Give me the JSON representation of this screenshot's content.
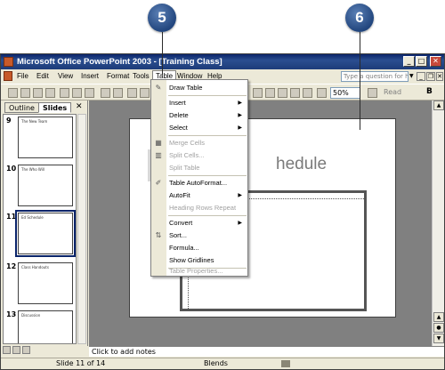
{
  "callouts": [
    "5",
    "6"
  ],
  "window": {
    "title": "Microsoft Office PowerPoint 2003 - [Training Class]",
    "buttons": {
      "minimize": "_",
      "maximize": "□",
      "close": "✕"
    }
  },
  "menubar": {
    "items": [
      "File",
      "Edit",
      "View",
      "Insert",
      "Format",
      "Tools",
      "Table",
      "Window",
      "Help"
    ],
    "help_placeholder": "Type a question for help",
    "mdi": {
      "minimize": "_",
      "restore": "❐",
      "close": "✕"
    }
  },
  "toolbar": {
    "zoom": "50%",
    "read": "Read",
    "bold": "B"
  },
  "leftpane": {
    "tabs": [
      "Outline",
      "Slides"
    ],
    "close": "✕",
    "slides": [
      {
        "num": "9",
        "title": "The New Team"
      },
      {
        "num": "10",
        "title": "The Who Will"
      },
      {
        "num": "11",
        "title": "Ed Schedule"
      },
      {
        "num": "12",
        "title": "Class Handouts"
      },
      {
        "num": "13",
        "title": "Discussion"
      }
    ]
  },
  "slide": {
    "heading": "hedule"
  },
  "table_menu": {
    "items": [
      {
        "label": "Draw Table",
        "icon": "pencil-icon",
        "disabled": false,
        "submenu": false
      },
      {
        "label": "Insert",
        "disabled": false,
        "submenu": true
      },
      {
        "label": "Delete",
        "disabled": false,
        "submenu": true
      },
      {
        "label": "Select",
        "disabled": false,
        "submenu": true
      },
      {
        "label": "Merge Cells",
        "icon": "merge-cells-icon",
        "disabled": true,
        "submenu": false
      },
      {
        "label": "Split Cells...",
        "icon": "split-cells-icon",
        "disabled": true,
        "submenu": false
      },
      {
        "label": "Split Table",
        "disabled": true,
        "submenu": false
      },
      {
        "label": "Table AutoFormat...",
        "icon": "autoformat-icon",
        "disabled": false,
        "submenu": false
      },
      {
        "label": "AutoFit",
        "disabled": false,
        "submenu": true
      },
      {
        "label": "Heading Rows Repeat",
        "disabled": true,
        "submenu": false
      },
      {
        "label": "Convert",
        "disabled": false,
        "submenu": true
      },
      {
        "label": "Sort...",
        "icon": "sort-icon",
        "disabled": false,
        "submenu": false
      },
      {
        "label": "Formula...",
        "disabled": false,
        "submenu": false
      },
      {
        "label": "Show Gridlines",
        "disabled": false,
        "submenu": false
      },
      {
        "label": "Table Properties...",
        "disabled": true,
        "submenu": false
      }
    ]
  },
  "notes": {
    "placeholder": "Click to add notes"
  },
  "statusbar": {
    "slide": "Slide 11 of 14",
    "design": "Blends"
  }
}
